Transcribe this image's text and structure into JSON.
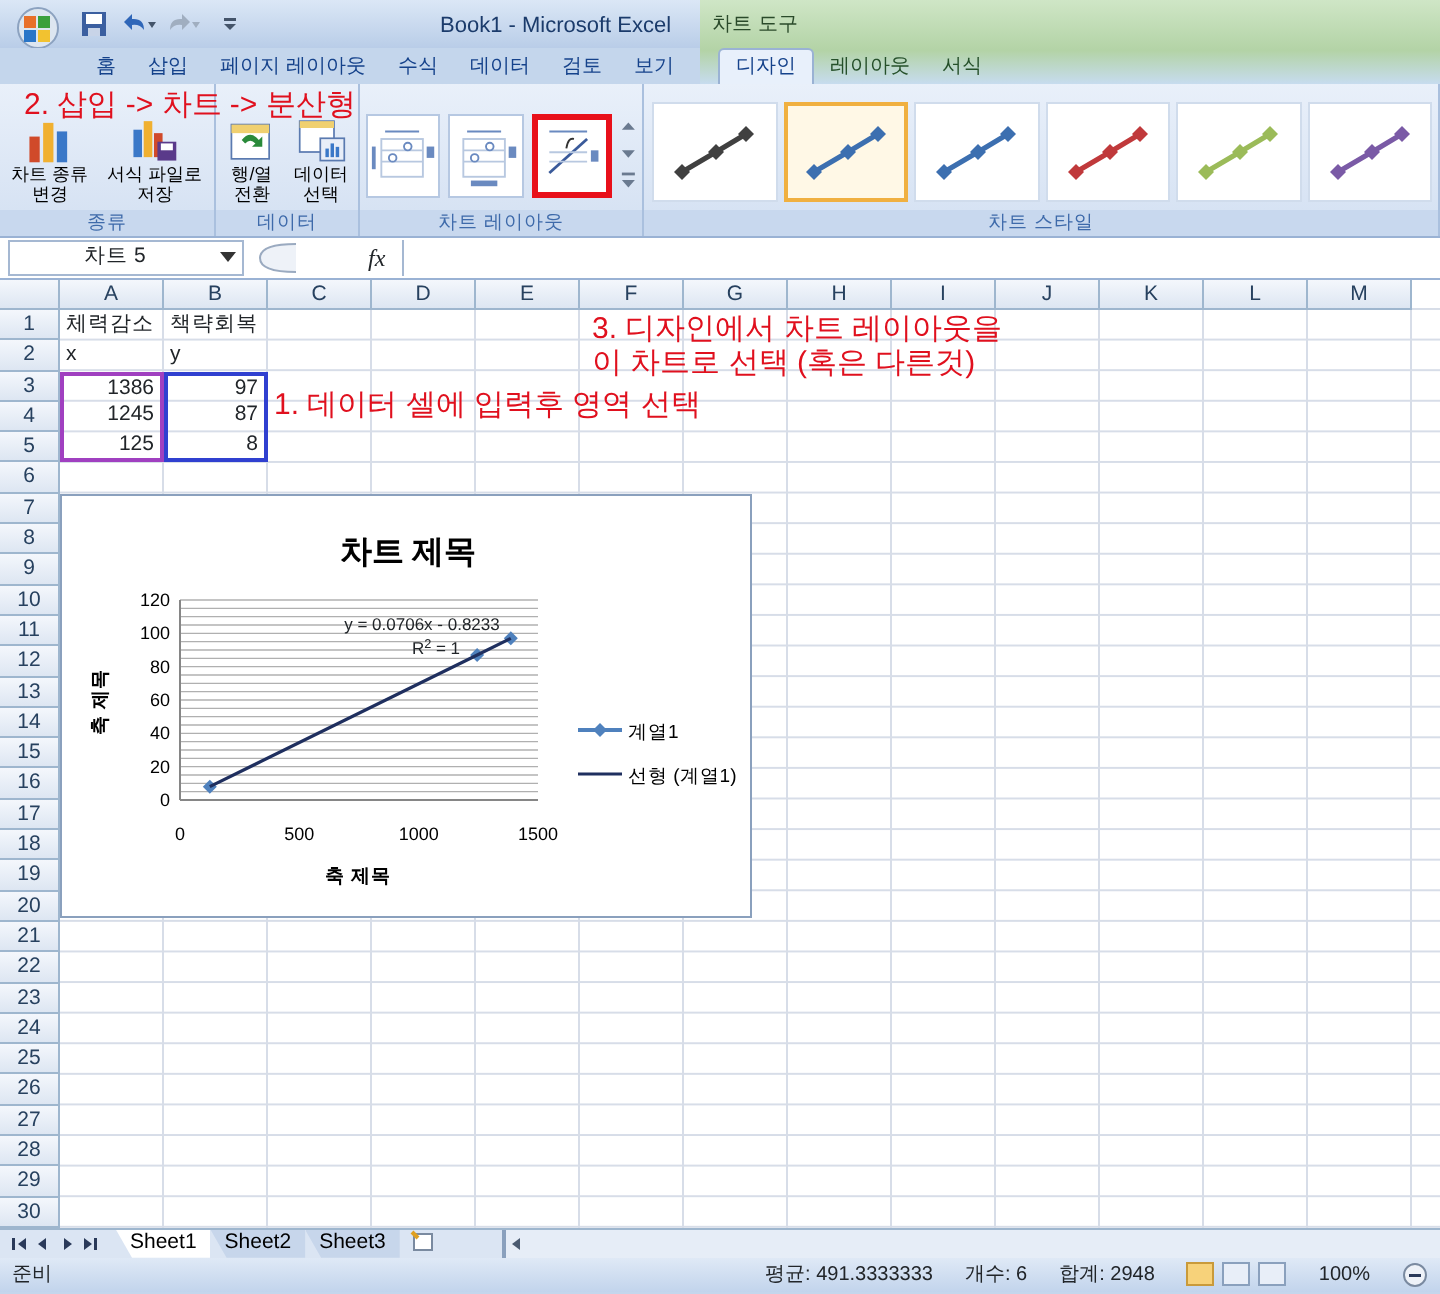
{
  "window": {
    "title": "Book1 - Microsoft Excel",
    "context_title": "차트 도구"
  },
  "tabs": [
    {
      "label": "홈",
      "selected": false,
      "contextual": false
    },
    {
      "label": "삽입",
      "selected": false,
      "contextual": false
    },
    {
      "label": "페이지 레이아웃",
      "selected": false,
      "contextual": false
    },
    {
      "label": "수식",
      "selected": false,
      "contextual": false
    },
    {
      "label": "데이터",
      "selected": false,
      "contextual": false
    },
    {
      "label": "검토",
      "selected": false,
      "contextual": false
    },
    {
      "label": "보기",
      "selected": false,
      "contextual": false
    },
    {
      "label": "디자인",
      "selected": true,
      "contextual": true
    },
    {
      "label": "레이아웃",
      "selected": false,
      "contextual": true
    },
    {
      "label": "서식",
      "selected": false,
      "contextual": true
    }
  ],
  "ribbon": {
    "groups": [
      {
        "label": "종류",
        "kind": "buttons",
        "buttons": [
          {
            "kind": "chart-type",
            "lines": [
              "차트 종류",
              "변경"
            ]
          },
          {
            "kind": "save-template",
            "lines": [
              "서식 파일로",
              "저장"
            ]
          }
        ]
      },
      {
        "label": "데이터",
        "kind": "buttons",
        "buttons": [
          {
            "kind": "switch",
            "lines": [
              "행/열",
              "전환"
            ]
          },
          {
            "kind": "select-data",
            "lines": [
              "데이터",
              "선택"
            ]
          }
        ]
      },
      {
        "label": "차트 레이아웃",
        "kind": "layouts",
        "items": [
          {
            "marked": false
          },
          {
            "marked": false
          },
          {
            "marked": true
          }
        ]
      },
      {
        "label": "차트 스타일",
        "kind": "styles",
        "items": [
          {
            "color": "#404040",
            "selected": false
          },
          {
            "color": "#3c6fb0",
            "selected": true
          },
          {
            "color": "#3c6fb0",
            "selected": false
          },
          {
            "color": "#c0393b",
            "selected": false
          },
          {
            "color": "#9bbb59",
            "selected": false
          },
          {
            "color": "#7a5aa6",
            "selected": false
          }
        ]
      }
    ]
  },
  "formula_bar": {
    "name_box": "차트 5",
    "fx": "fx"
  },
  "sheet": {
    "columns": [
      "A",
      "B",
      "C",
      "D",
      "E",
      "F",
      "G",
      "H",
      "I",
      "J",
      "K",
      "L",
      "M"
    ],
    "rows": [
      {
        "number": "1",
        "cells": [
          {
            "text": "체력감소",
            "kind": "text"
          },
          {
            "text": "책략회복",
            "kind": "text"
          }
        ]
      },
      {
        "number": "2",
        "cells": [
          {
            "text": "x",
            "kind": "text"
          },
          {
            "text": "y",
            "kind": "text"
          }
        ]
      },
      {
        "number": "3",
        "cells": [
          {
            "text": "1386",
            "kind": "number",
            "color": "#a040c0"
          },
          {
            "text": "97",
            "kind": "number",
            "color": "#3040d0"
          }
        ]
      },
      {
        "number": "4",
        "cells": [
          {
            "text": "1245",
            "kind": "number",
            "color": "#a040c0"
          },
          {
            "text": "87",
            "kind": "number",
            "color": "#3040d0"
          }
        ]
      },
      {
        "number": "5",
        "cells": [
          {
            "text": "125",
            "kind": "number",
            "color": "#a040c0"
          },
          {
            "text": "8",
            "kind": "number",
            "color": "#3040d0"
          }
        ]
      },
      {
        "number": "6"
      },
      {
        "number": "7"
      },
      {
        "number": "8"
      },
      {
        "number": "9"
      },
      {
        "number": "10"
      },
      {
        "number": "11"
      },
      {
        "number": "12"
      },
      {
        "number": "13"
      },
      {
        "number": "14"
      },
      {
        "number": "15"
      },
      {
        "number": "16"
      },
      {
        "number": "17"
      },
      {
        "number": "18"
      },
      {
        "number": "19"
      },
      {
        "number": "20"
      },
      {
        "number": "21"
      },
      {
        "number": "22"
      },
      {
        "number": "23"
      },
      {
        "number": "24"
      },
      {
        "number": "25"
      },
      {
        "number": "26"
      },
      {
        "number": "27"
      },
      {
        "number": "28"
      },
      {
        "number": "29"
      },
      {
        "number": "30"
      }
    ]
  },
  "chart": {
    "chart_data": {
      "type": "scatter",
      "title": "차트 제목",
      "xlabel": "축 제목",
      "ylabel": "축 제목",
      "x": [
        1386,
        1245,
        125
      ],
      "series": [
        {
          "name": "계열1",
          "color": "#4f81bd",
          "values": [
            97,
            87,
            8
          ]
        },
        {
          "name": "선형 (계열1)",
          "color": "#1f2f5f",
          "type": "line",
          "values": [
            97,
            87,
            8
          ]
        }
      ],
      "grid": true,
      "legend": true,
      "xlim": [
        0,
        1500
      ],
      "ylim": [
        0,
        120
      ],
      "xticks": [
        0,
        500,
        1000,
        1500
      ],
      "yticks": [
        0,
        20,
        40,
        60,
        80,
        100,
        120
      ],
      "annotations": [
        "y = 0.0706x - 0.8233",
        "R$^{2}$ = 1"
      ]
    }
  },
  "annotations": [
    {
      "kind": "step",
      "lines": [
        "2. 삽입 -> 차트 -> 분산형"
      ]
    },
    {
      "kind": "step",
      "lines": [
        "3. 디자인에서 차트 레이아웃을",
        "이 차트로 선택 (혹은 다른것)"
      ]
    },
    {
      "kind": "step",
      "lines": [
        "1. 데이터 셀에 입력후 영역 선택"
      ]
    }
  ],
  "sheet_tabs": [
    {
      "label": "Sheet1",
      "selected": true
    },
    {
      "label": "Sheet2",
      "selected": false
    },
    {
      "label": "Sheet3",
      "selected": false
    }
  ],
  "status_bar": {
    "mode": "준비",
    "stats": [
      "평균: 491.3333333",
      "개수: 6",
      "합계: 2948"
    ],
    "views": [
      {
        "selected": true
      },
      {
        "selected": false
      },
      {
        "selected": false
      }
    ],
    "zoom": "100%"
  }
}
